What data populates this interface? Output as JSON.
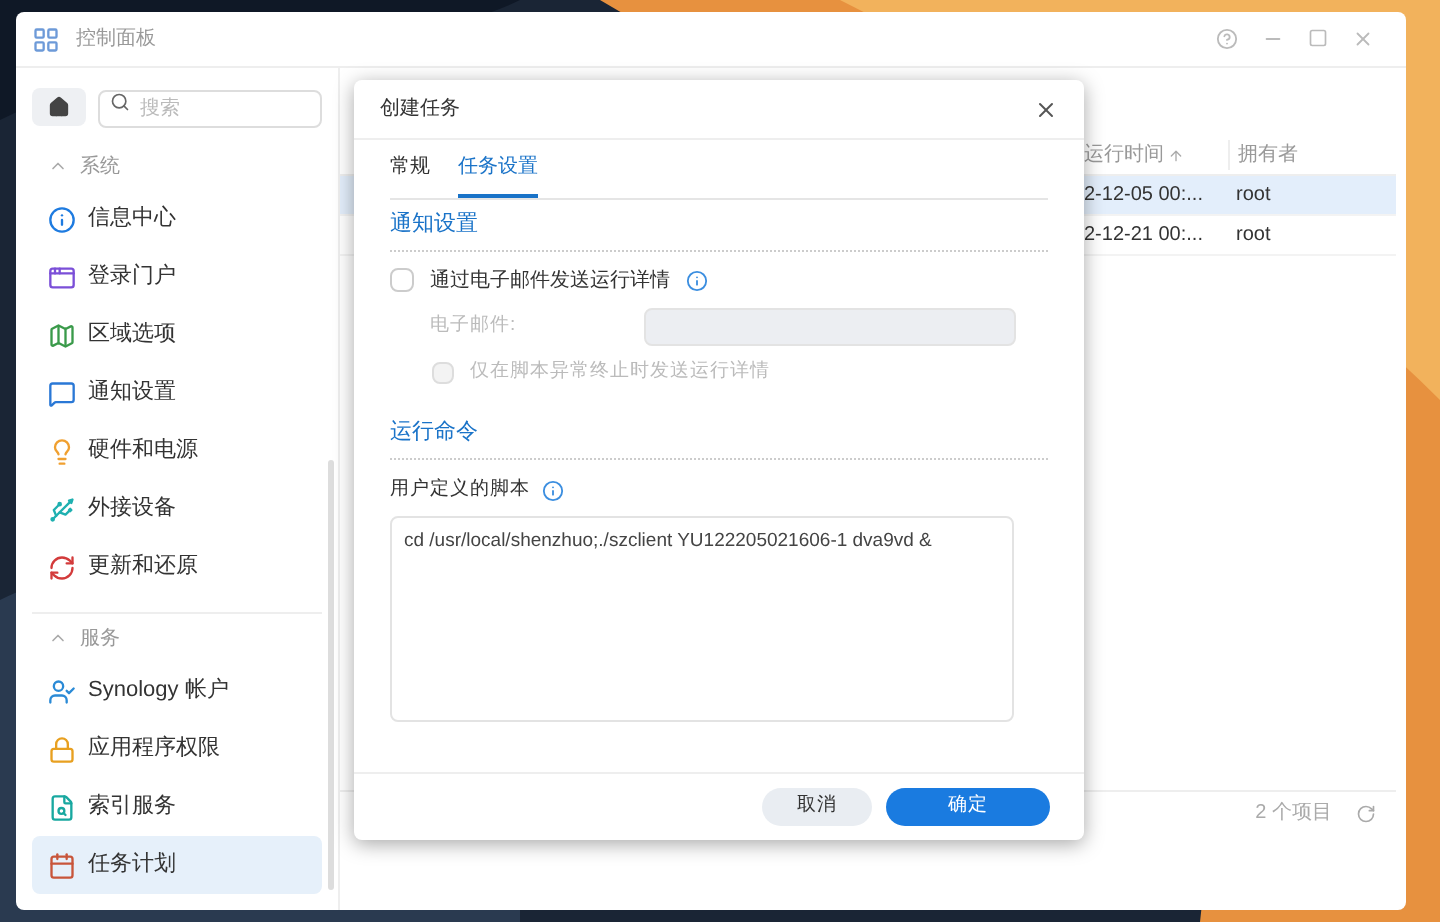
{
  "window": {
    "title": "控制面板"
  },
  "search": {
    "placeholder": "搜索"
  },
  "sidebar": {
    "groups": [
      {
        "title": "系统",
        "expanded": true,
        "items": [
          {
            "label": "信息中心",
            "selected": false
          },
          {
            "label": "登录门户",
            "selected": false
          },
          {
            "label": "区域选项",
            "selected": false
          },
          {
            "label": "通知设置",
            "selected": false
          },
          {
            "label": "硬件和电源",
            "selected": false
          },
          {
            "label": "外接设备",
            "selected": false
          },
          {
            "label": "更新和还原",
            "selected": false
          }
        ]
      },
      {
        "title": "服务",
        "expanded": true,
        "items": [
          {
            "label": "Synology 帐户",
            "selected": false
          },
          {
            "label": "应用程序权限",
            "selected": false
          },
          {
            "label": "索引服务",
            "selected": false
          },
          {
            "label": "任务计划",
            "selected": true
          }
        ]
      }
    ]
  },
  "table": {
    "columns": [
      "运行时间",
      "拥有者"
    ],
    "rows": [
      {
        "cells": [
          "2-12-05 00:...",
          "root"
        ],
        "selected": true
      },
      {
        "cells": [
          "2-12-21 00:...",
          "root"
        ],
        "selected": false
      }
    ]
  },
  "status_bar": {
    "count": "2 个项目"
  },
  "dialog": {
    "title": "创建任务",
    "tabs": [
      {
        "label": "常规",
        "selected": false
      },
      {
        "label": "任务设置",
        "selected": true
      }
    ],
    "notification": {
      "title": "通知设置",
      "email_option": {
        "label": "通过电子邮件发送运行详情",
        "checked": false
      },
      "email_field": {
        "label": "电子邮件:",
        "disabled": true
      },
      "abnormal_option": {
        "label": "仅在脚本异常终止时发送运行详情",
        "checked": false,
        "disabled": true
      }
    },
    "command": {
      "title": "运行命令",
      "script_label": "用户定义的脚本",
      "script": "cd /usr/local/shenzhuo;./szclient YU122205021606-1 dva9vd &"
    },
    "buttons": {
      "cancel": "取消",
      "ok": "确定"
    }
  }
}
